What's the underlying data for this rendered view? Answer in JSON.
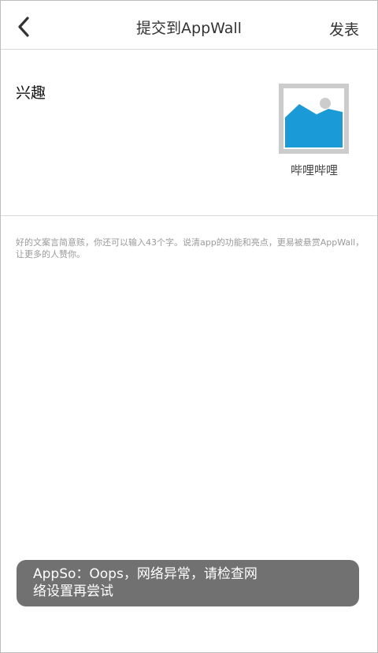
{
  "header": {
    "back_icon": "chevron-left-icon",
    "title": "提交到AppWall",
    "publish_label": "发表"
  },
  "form": {
    "interest_value": "兴趣",
    "app": {
      "icon": "image-placeholder-icon",
      "name": "哔哩哔哩"
    },
    "hint": "好的文案言简意赅，你还可以输入43个字。说清app的功能和亮点，更易被悬赏AppWall，让更多的人赞你。"
  },
  "toast": {
    "message": "AppSo：Oops，网络异常，请检查网络设置再尝试"
  },
  "colors": {
    "placeholder_frame": "#cccccc",
    "placeholder_mountain": "#1a9ad6",
    "toast_bg": "#717171"
  }
}
